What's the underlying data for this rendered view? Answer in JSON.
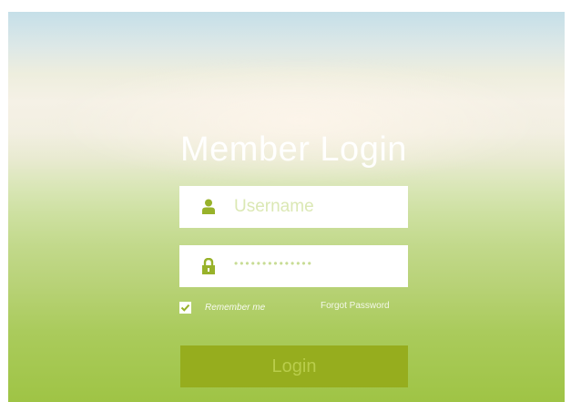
{
  "login": {
    "title": "Member Login",
    "username_placeholder": "Username",
    "password_mask": "••••••••••••••",
    "remember_label": "Remember me",
    "remember_checked": true,
    "forgot_label": "Forgot Password",
    "login_label": "Login"
  },
  "icons": {
    "username": "user-icon",
    "password": "lock-icon",
    "remember": "check-icon"
  },
  "colors": {
    "accent": "#96ad1e",
    "icon": "#98b22a",
    "sky": "#c5dfe8",
    "meadow": "#9fc445"
  }
}
